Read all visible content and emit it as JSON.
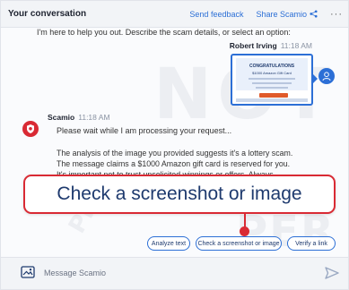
{
  "header": {
    "title": "Your conversation",
    "send_feedback": "Send feedback",
    "share": "Share Scamio",
    "more": "···"
  },
  "messages": {
    "top_text": "I'm here to help you out. Describe the scam details, or select an option:",
    "user_name": "Robert Irving",
    "user_time": "11:18 AM",
    "thumbnail": {
      "banner_title": "CONGRATULATIONS",
      "banner_sub": "$1000 Amazon Gift Card"
    },
    "bot_name": "Scamio",
    "bot_time": "11:18 AM",
    "bot_processing": "Please wait while I am processing your request...",
    "bot_analysis": "The analysis of the image you provided suggests it's a lottery scam. The message claims a $1000 Amazon gift card is reserved for you. It's important not to trust unsolicited winnings or offers. Always verify their legitimacy and"
  },
  "callout": {
    "label": "Check a screenshot or image"
  },
  "chips": [
    "Analyze text",
    "Check a screenshot or image",
    "Verify a link"
  ],
  "composer": {
    "placeholder": "Message Scamio"
  },
  "watermark": {
    "text_1": "NOT",
    "text_2": "PER",
    "text_3": "PRO"
  },
  "colors": {
    "accent": "#2c6fd6",
    "highlight": "#d92a34",
    "text_dark": "#1e3a6e"
  },
  "icons": {
    "share": "share-icon",
    "user_avatar": "user-avatar-icon",
    "bot_avatar": "scamio-shield-icon",
    "attach": "image-attach-icon",
    "send": "send-icon"
  }
}
